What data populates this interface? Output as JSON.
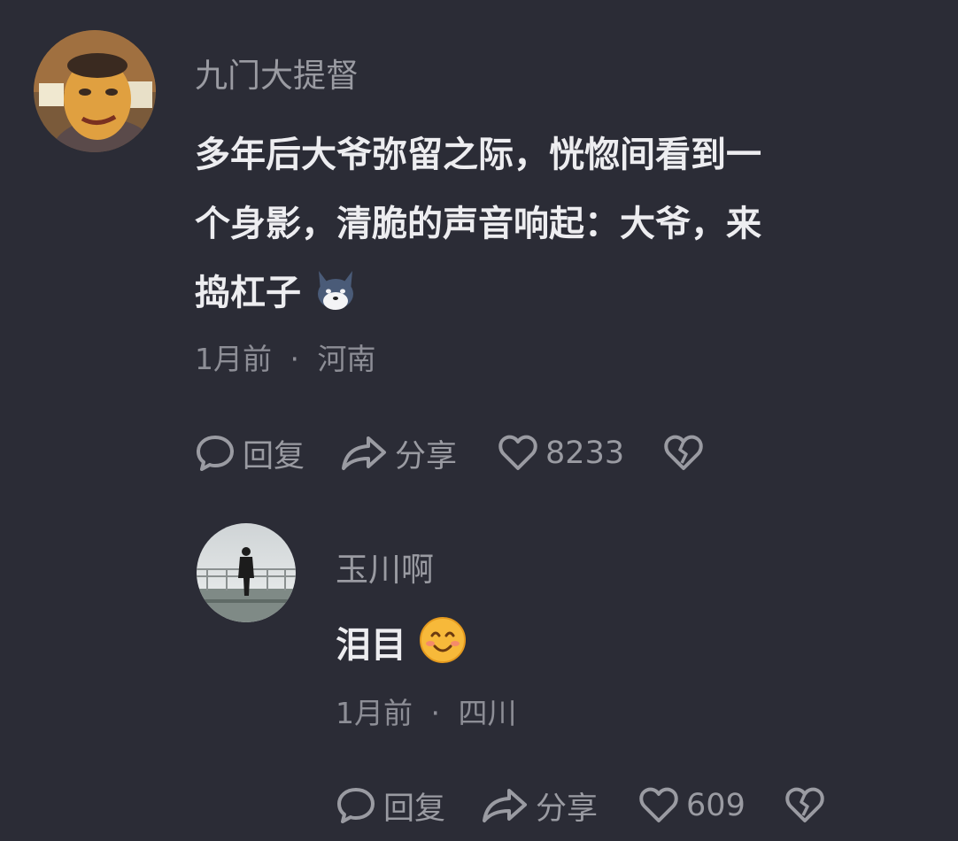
{
  "comments": [
    {
      "username": "九门大提督",
      "text_lines": [
        "多年后大爷弥留之际，恍惚间看到一",
        "个身影，清脆的声音响起：大爷，来",
        "捣杠子"
      ],
      "emoji": "wolf-face-emoji",
      "time": "1月前",
      "separator": "·",
      "location": "河南",
      "reply_label": "回复",
      "share_label": "分享",
      "likes": "8233"
    },
    {
      "username": "玉川啊",
      "text_lines": [
        "泪目"
      ],
      "emoji": "smiling-face-emoji",
      "time": "1月前",
      "separator": "·",
      "location": "四川",
      "reply_label": "回复",
      "share_label": "分享",
      "likes": "609"
    }
  ],
  "icons": {
    "reply": "speech-bubble-icon",
    "share": "share-arrow-icon",
    "like": "heart-outline-icon",
    "dislike": "broken-heart-icon"
  },
  "colors": {
    "background": "#2b2c36",
    "primary_text": "#ededf0",
    "secondary_text": "#9a9ba2"
  }
}
